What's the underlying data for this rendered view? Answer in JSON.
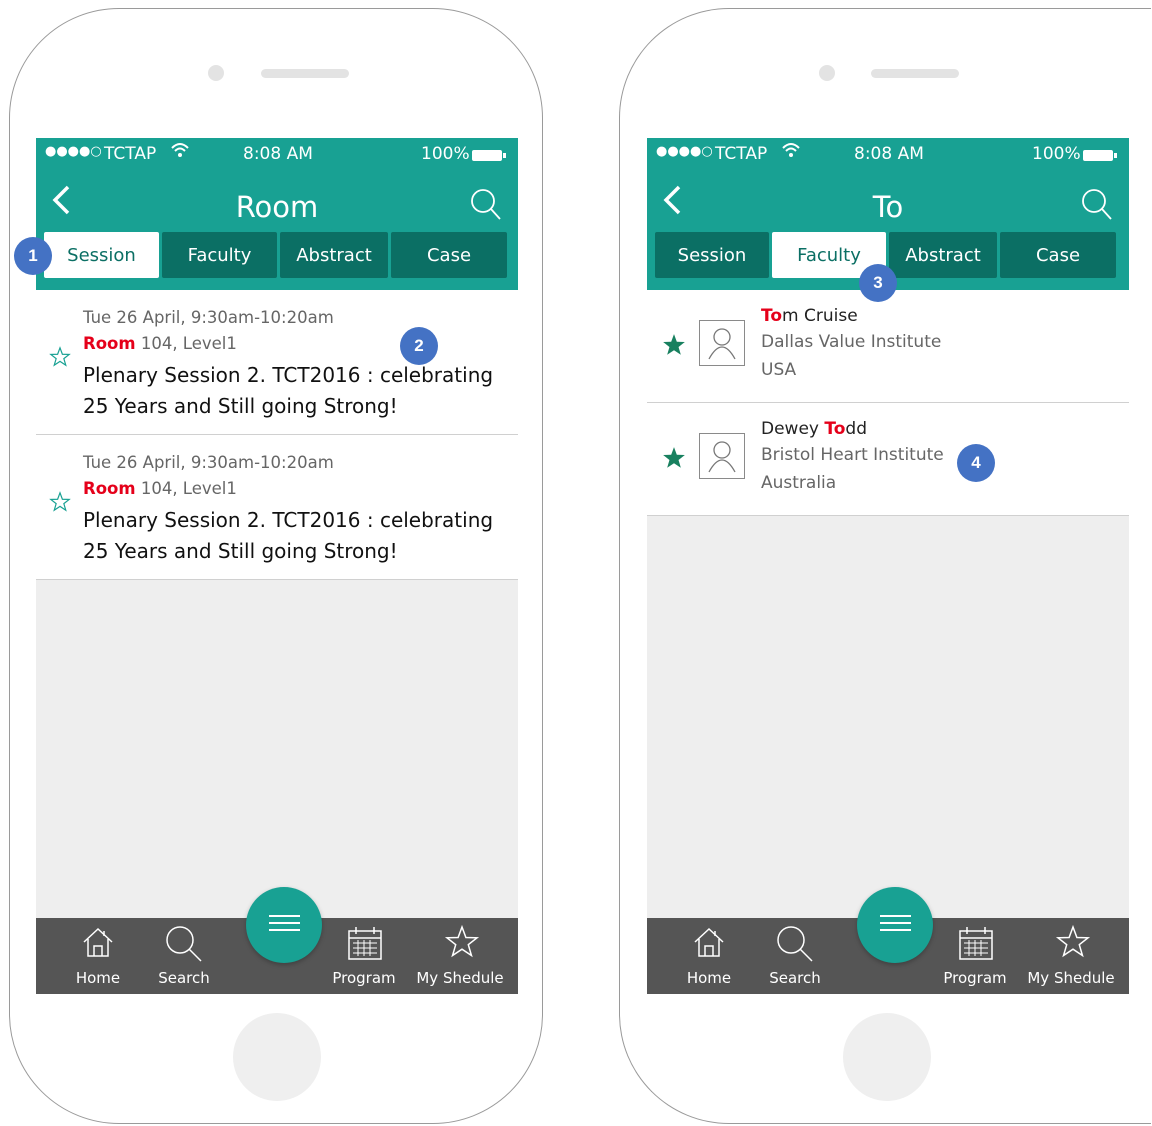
{
  "left": {
    "status": {
      "dots": "●●●●○",
      "carrier": "TCTAP",
      "time": "8:08 AM",
      "battery": "100%"
    },
    "title": "Room",
    "tabs": [
      {
        "label": "Session"
      },
      {
        "label": "Faculty"
      },
      {
        "label": "Abstract"
      },
      {
        "label": "Case"
      }
    ],
    "sessions": [
      {
        "datetime": "Tue 26 April, 9:30am-10:20am",
        "room_highlight": "Room",
        "room_rest": " 104, Level1",
        "name": "Plenary Session 2. TCT2016 : celebrating 25 Years and Still going Strong!"
      },
      {
        "datetime": "Tue 26 April, 9:30am-10:20am",
        "room_highlight": "Room",
        "room_rest": " 104, Level1",
        "name": "Plenary Session 2. TCT2016 : celebrating 25 Years and Still going Strong!"
      }
    ],
    "nav": {
      "home": "Home",
      "search": "Search",
      "program": "Program",
      "schedule": "My Shedule"
    }
  },
  "right": {
    "status": {
      "dots": "●●●●○",
      "carrier": "TCTAP",
      "time": "8:08 AM",
      "battery": "100%"
    },
    "title": "To",
    "tabs": [
      {
        "label": "Session"
      },
      {
        "label": "Faculty"
      },
      {
        "label": "Abstract"
      },
      {
        "label": "Case"
      }
    ],
    "faculty": [
      {
        "name_pre": "",
        "name_highlight": "To",
        "name_post": "m Cruise",
        "institute": "Dallas Value Institute",
        "country": "USA"
      },
      {
        "name_pre": "Dewey ",
        "name_highlight": "To",
        "name_post": "dd",
        "institute": "Bristol Heart Institute",
        "country": "Australia"
      }
    ],
    "nav": {
      "home": "Home",
      "search": "Search",
      "program": "Program",
      "schedule": "My Shedule"
    }
  },
  "markers": [
    "1",
    "2",
    "3",
    "4"
  ],
  "colors": {
    "teal": "#18a193",
    "dark_teal": "#0b6f64",
    "highlight": "#e5001a",
    "marker": "#4472c4",
    "tabbar": "#555555"
  },
  "icons": [
    "back-chevron-icon",
    "search-icon",
    "star-outline-icon",
    "star-filled-icon",
    "person-avatar-icon",
    "home-icon",
    "calendar-icon",
    "menu-icon",
    "wifi-icon",
    "battery-icon"
  ]
}
